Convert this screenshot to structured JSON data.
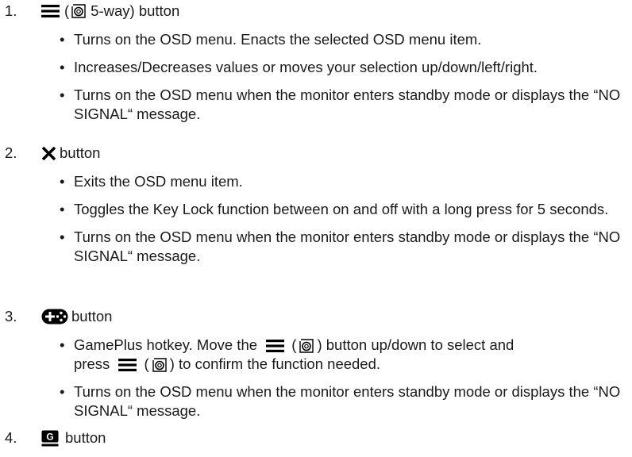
{
  "items": [
    {
      "number": "1.",
      "paren_open": "(",
      "head_text": "5-way) button",
      "icons": [
        "menu-icon",
        "five-way-dial-icon"
      ],
      "bullets": [
        "Turns on the OSD menu. Enacts the selected OSD menu item.",
        "Increases/Decreases values or moves your selection up/down/left/right.",
        "Turns on the OSD menu when the monitor enters standby mode or displays the “NO SIGNAL“ message."
      ]
    },
    {
      "number": "2.",
      "head_text": "button",
      "icons": [
        "close-icon"
      ],
      "bullets": [
        "Exits the OSD menu item.",
        "Toggles the Key Lock function between on and off with a long press for 5 seconds.",
        "Turns on the OSD menu when the monitor enters standby mode or displays the “NO SIGNAL“ message."
      ]
    },
    {
      "number": "3.",
      "head_text": "button",
      "icons": [
        "gameplus-icon"
      ],
      "bullets": [
        {
          "part1": "GamePlus hotkey. Move the",
          "paren_open": "(",
          "part2": ") button up/down to select and",
          "part3": "press",
          "paren_open_2": "(",
          "part4": ") to confirm the function needed."
        },
        "Turns on the OSD menu when the monitor enters standby mode or displays the “NO SIGNAL“ message."
      ]
    },
    {
      "number": "4.",
      "head_text": "button",
      "icons": [
        "gamevisual-icon"
      ],
      "icon_letter": "G"
    }
  ],
  "colors": {
    "text": "#1a1a1a",
    "icon": "#000000",
    "background": "#ffffff"
  }
}
